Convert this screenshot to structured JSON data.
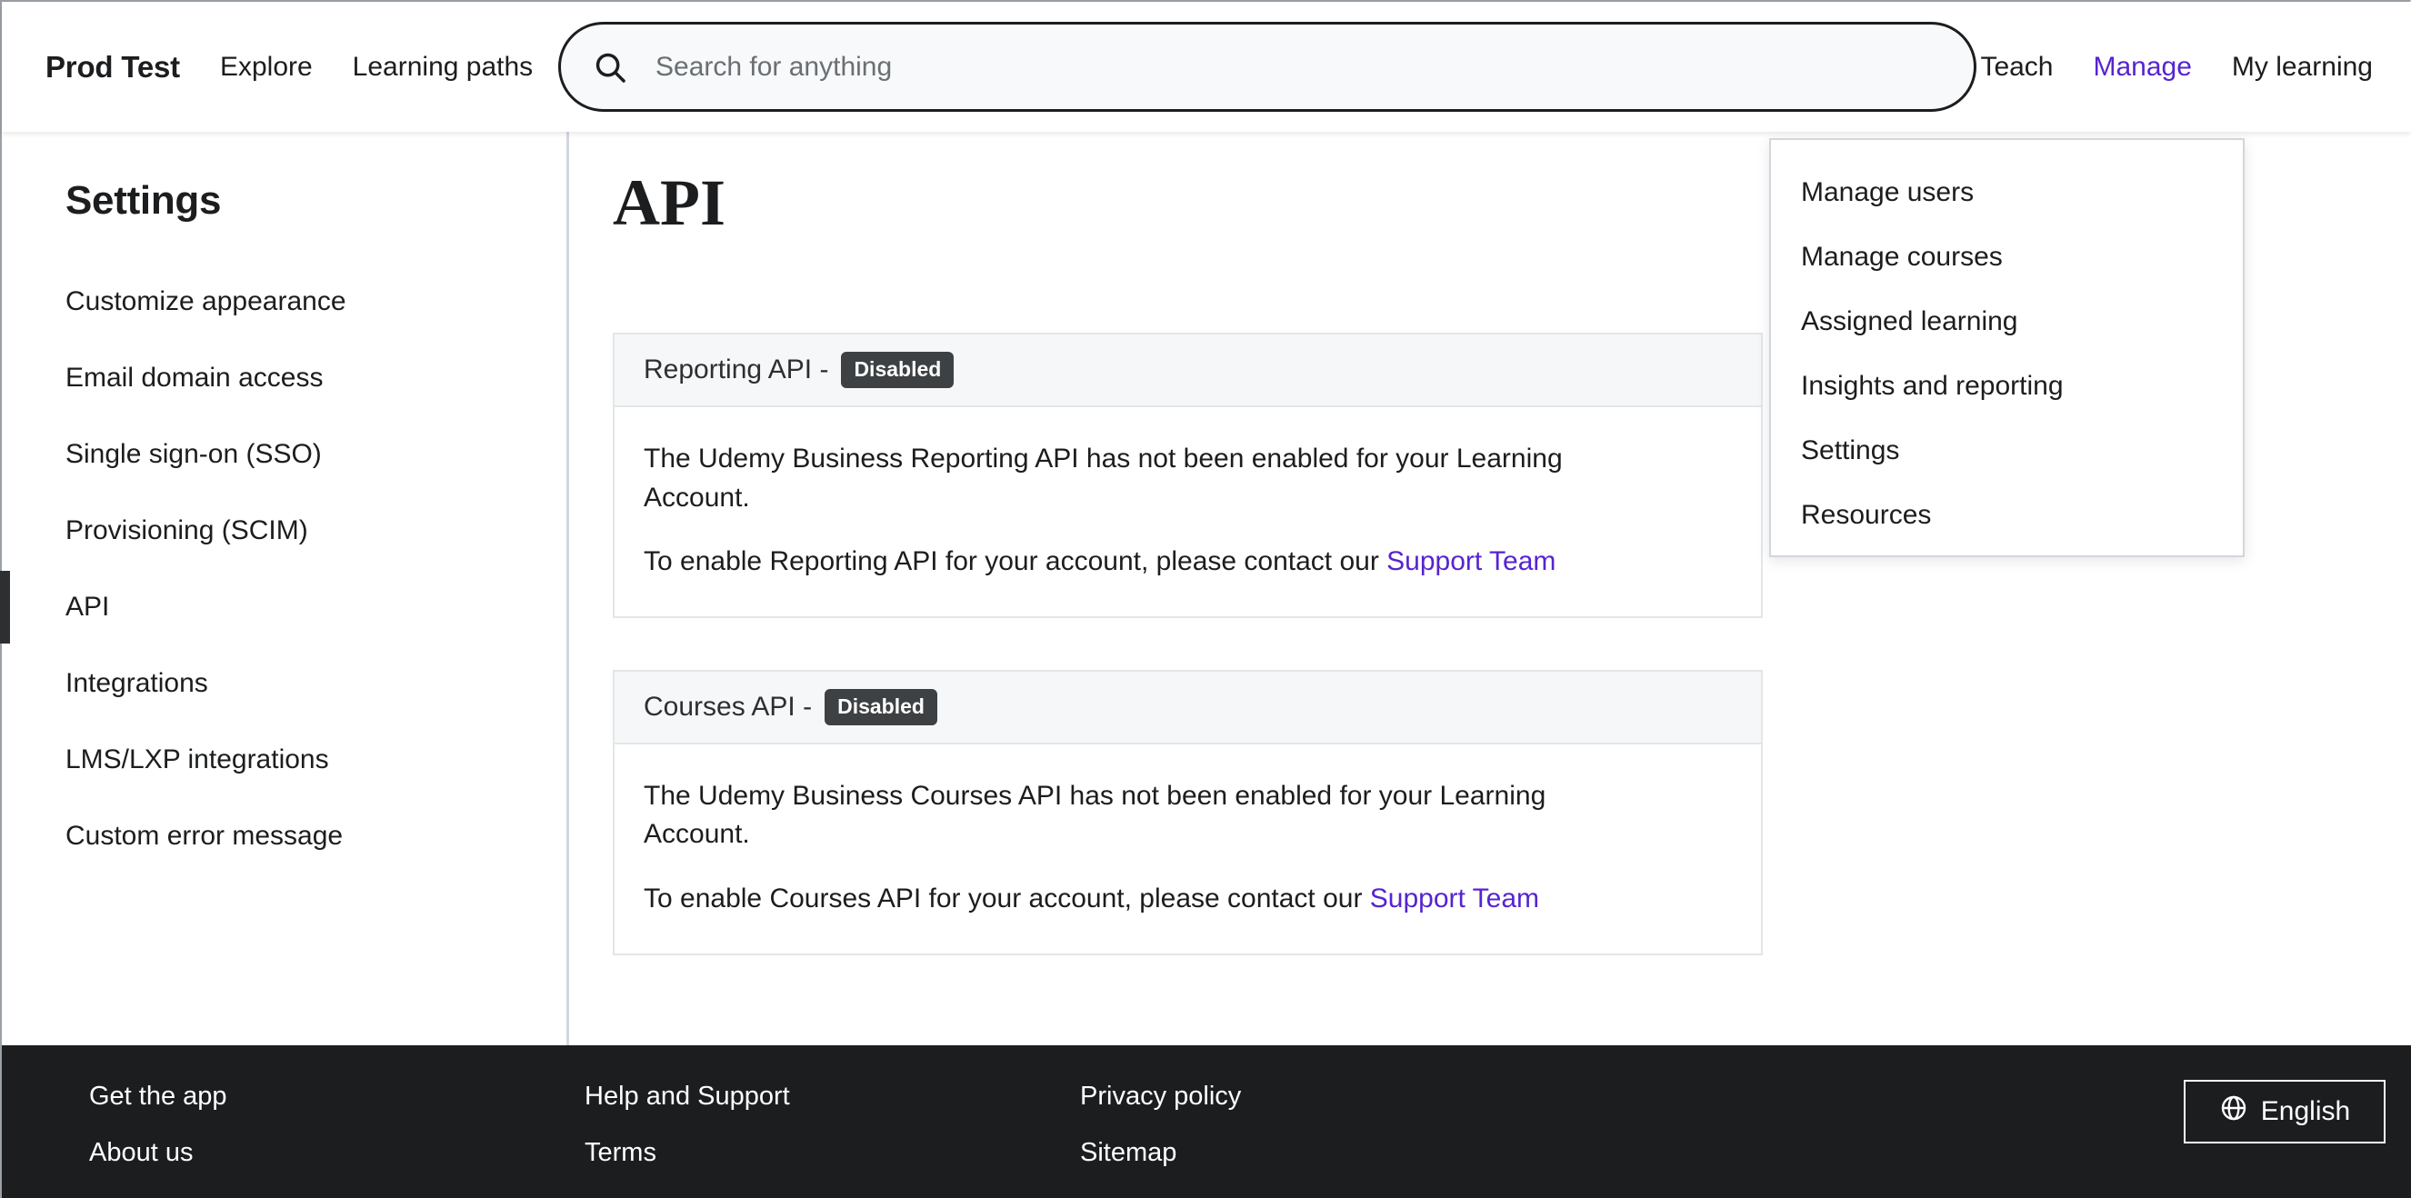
{
  "header": {
    "brand": "Prod Test",
    "nav_left": [
      {
        "label": "Explore"
      },
      {
        "label": "Learning paths"
      }
    ],
    "search": {
      "placeholder": "Search for anything",
      "value": "",
      "icon": "search-icon"
    },
    "nav_right": [
      {
        "label": "Teach",
        "active": false
      },
      {
        "label": "Manage",
        "active": true
      },
      {
        "label": "My learning",
        "active": false
      }
    ],
    "accent_color": "#5624d0"
  },
  "manage_dropdown": {
    "items": [
      {
        "label": "Manage users"
      },
      {
        "label": "Manage courses"
      },
      {
        "label": "Assigned learning"
      },
      {
        "label": "Insights and reporting"
      },
      {
        "label": "Settings"
      },
      {
        "label": "Resources"
      }
    ]
  },
  "sidebar": {
    "title": "Settings",
    "items": [
      {
        "label": "Customize appearance",
        "active": false
      },
      {
        "label": "Email domain access",
        "active": false
      },
      {
        "label": "Single sign-on (SSO)",
        "active": false
      },
      {
        "label": "Provisioning (SCIM)",
        "active": false
      },
      {
        "label": "API",
        "active": true
      },
      {
        "label": "Integrations",
        "active": false
      },
      {
        "label": "LMS/LXP integrations",
        "active": false
      },
      {
        "label": "Custom error message",
        "active": false
      }
    ],
    "active_indicator_color": "#2d2f31"
  },
  "main": {
    "page_title": "API",
    "cards": [
      {
        "header_label": "Reporting API -",
        "status_badge": "Disabled",
        "paragraph_1": "The Udemy Business Reporting API has not been enabled for your Learning Account.",
        "paragraph_2_prefix": "To enable Reporting API for your account, please contact our ",
        "paragraph_2_link": "Support Team"
      },
      {
        "header_label": "Courses API -",
        "status_badge": "Disabled",
        "paragraph_1": "The Udemy Business Courses API has not been enabled for your Learning Account.",
        "paragraph_2_prefix": "To enable Courses API for your account, please contact our ",
        "paragraph_2_link": "Support Team"
      }
    ],
    "badge_color": "#3e4143",
    "link_color": "#5624d0"
  },
  "footer": {
    "background": "#1c1d1f",
    "columns": [
      {
        "links": [
          {
            "label": "Get the app"
          },
          {
            "label": "About us"
          }
        ]
      },
      {
        "links": [
          {
            "label": "Help and Support"
          },
          {
            "label": "Terms"
          }
        ]
      },
      {
        "links": [
          {
            "label": "Privacy policy"
          },
          {
            "label": "Sitemap"
          }
        ]
      }
    ],
    "language_button": {
      "label": "English",
      "icon": "globe-icon"
    }
  }
}
